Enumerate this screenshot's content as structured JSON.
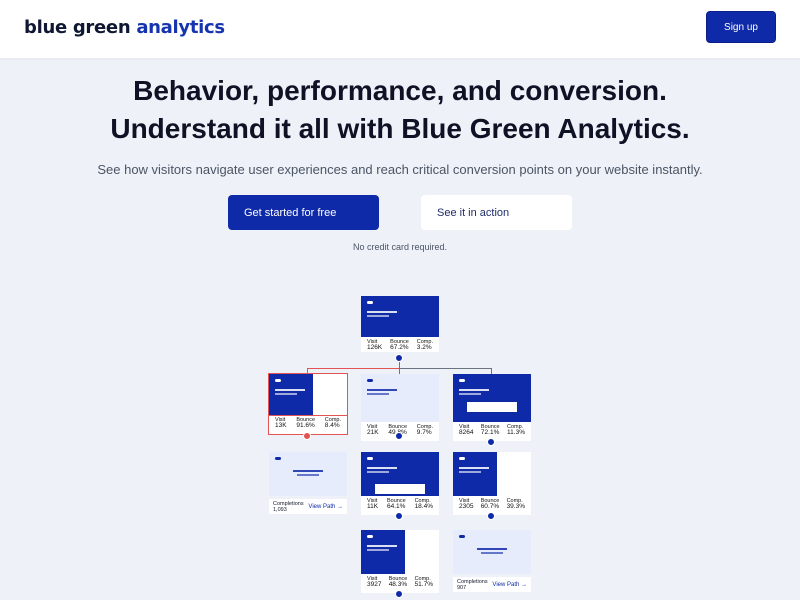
{
  "header": {
    "logo_part1": "blue green ",
    "logo_part2": "analytics",
    "signup_label": "Sign up"
  },
  "hero": {
    "headline_line1": "Behavior, performance, and conversion.",
    "headline_line2": "Understand it all with Blue Green Analytics.",
    "subheadline": "See how visitors navigate user experiences and reach critical conversion points on your website instantly.",
    "cta_primary": "Get started for free",
    "cta_secondary": "See it in action",
    "note": "No credit card required."
  },
  "flow": {
    "labels": {
      "visit": "Visit",
      "bounce": "Bounce",
      "comp": "Comp.",
      "completions": "Completions",
      "view_path": "View Path",
      "arrow": "→"
    },
    "nodes": [
      {
        "visit": "126K",
        "bounce": "67.2%",
        "comp": "3.2%"
      },
      {
        "visit": "13K",
        "bounce": "91.6%",
        "comp": "8.4%"
      },
      {
        "visit": "21K",
        "bounce": "49.8%",
        "comp": "9.7%"
      },
      {
        "visit": "8264",
        "bounce": "72.1%",
        "comp": "11.3%"
      },
      {
        "completions": "1,093"
      },
      {
        "visit": "11K",
        "bounce": "64.1%",
        "comp": "18.4%"
      },
      {
        "visit": "2305",
        "bounce": "60.7%",
        "comp": "39.3%"
      },
      {
        "visit": "3927",
        "bounce": "48.3%",
        "comp": "51.7%"
      },
      {
        "completions": "907"
      }
    ]
  }
}
